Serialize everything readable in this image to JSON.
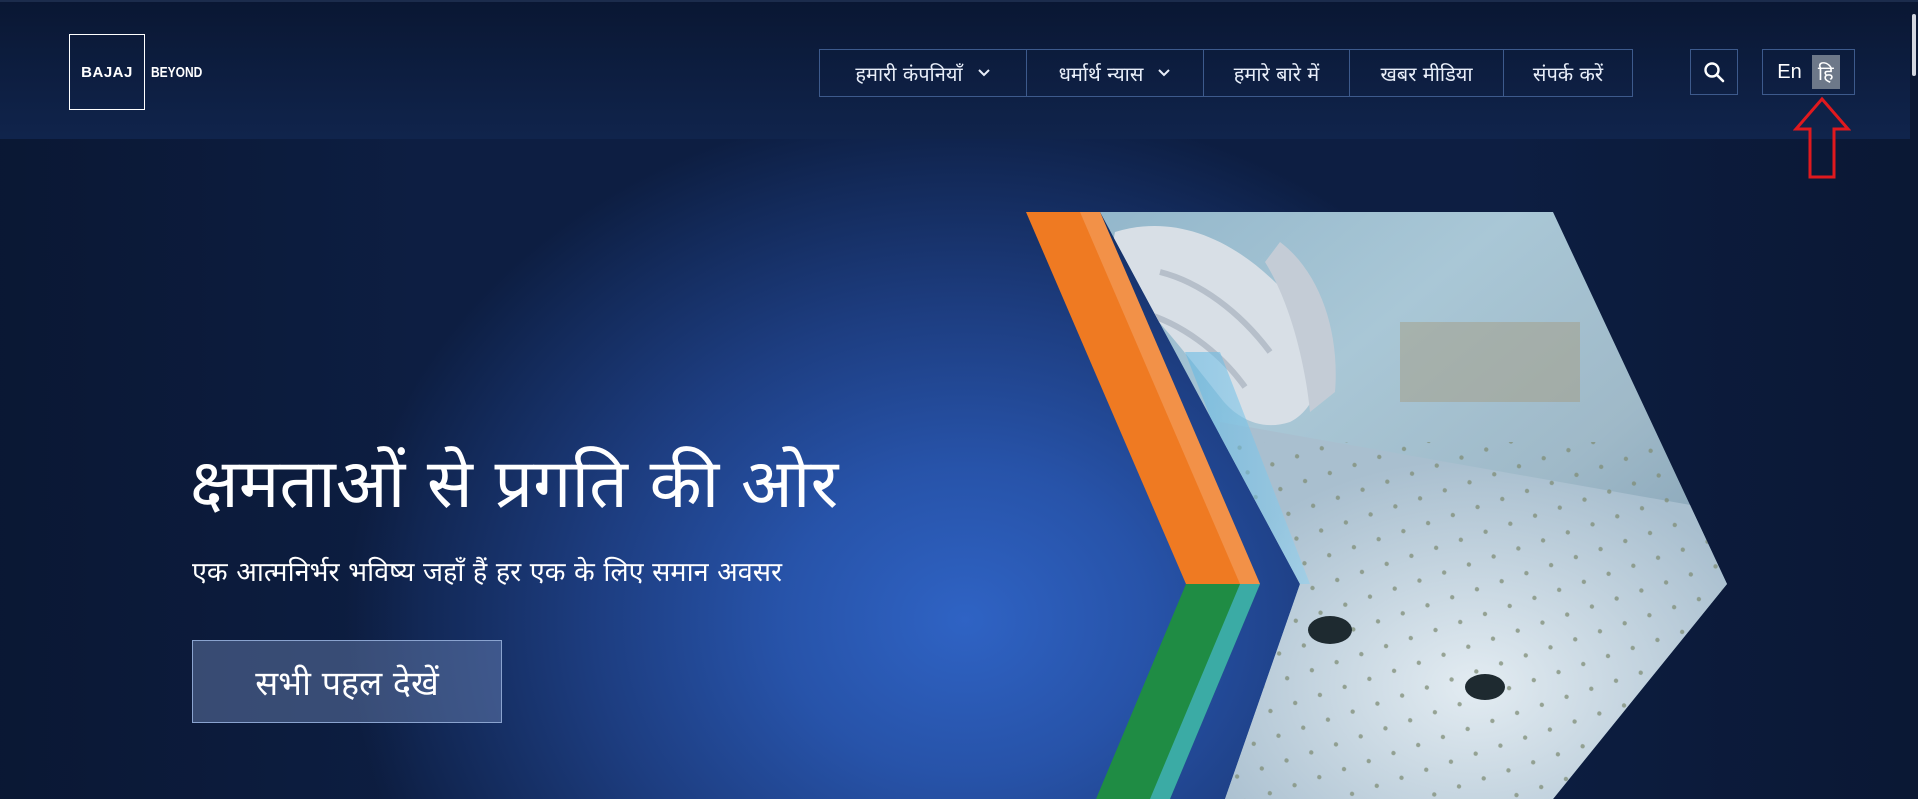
{
  "header": {
    "logo": {
      "box_text": "BAJAJ",
      "suffix_text": "BEYOND"
    },
    "nav": [
      {
        "label": "हमारी कंपनियाँ",
        "has_dropdown": true
      },
      {
        "label": "धर्मार्थ न्यास",
        "has_dropdown": true
      },
      {
        "label": "हमारे बारे में",
        "has_dropdown": false
      },
      {
        "label": "खबर मीडिया",
        "has_dropdown": false
      },
      {
        "label": "संपर्क करें",
        "has_dropdown": false
      }
    ],
    "search_icon": "search-icon",
    "language": {
      "en_label": "En",
      "hi_label": "हि",
      "selected": "hi"
    }
  },
  "hero": {
    "title": "क्षमताओं से प्रगति की ओर",
    "subtitle": "एक आत्मनिर्भर भविष्य जहाँ हैं हर एक के लिए समान अवसर",
    "cta_label": "सभी पहल देखें"
  },
  "colors": {
    "accent_orange": "#ef7a22",
    "accent_green": "#1f8c44",
    "annotation_red": "#e0191e",
    "hero_blue": "#2f63c4",
    "header_navy": "#0a1733"
  }
}
